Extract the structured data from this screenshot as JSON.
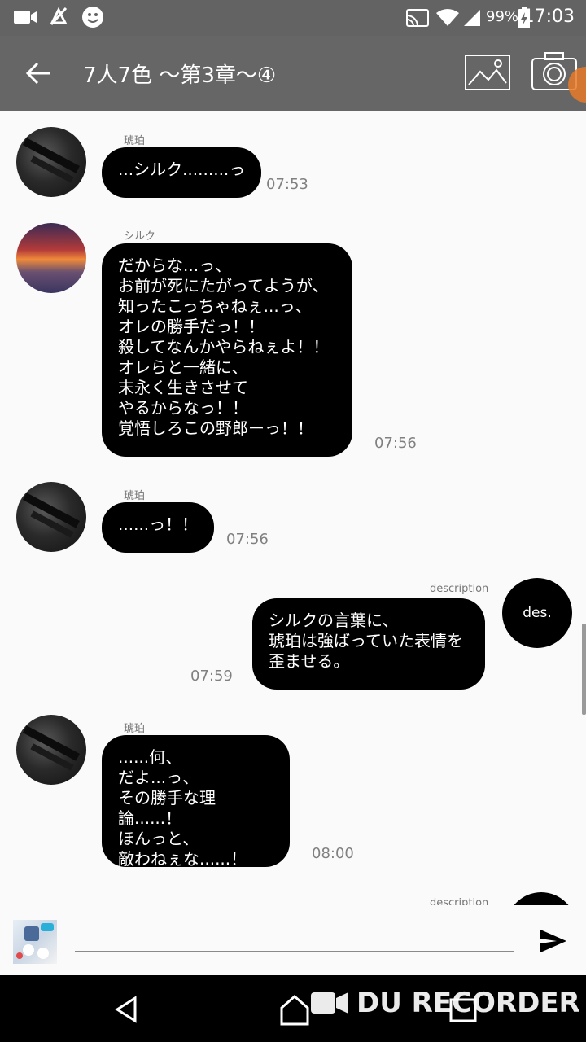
{
  "status_bar": {
    "time": "17:03",
    "battery": "99%",
    "icons": [
      "video-recording-icon",
      "mute-icon",
      "smiley-icon",
      "cast-icon",
      "wifi-icon",
      "signal-icon",
      "battery-charging-icon"
    ]
  },
  "app_bar": {
    "title": "7人7色 〜第3章〜④",
    "icons": [
      "back-arrow-icon",
      "image-icon",
      "camera-icon"
    ]
  },
  "messages": [
    {
      "sender": "琥珀",
      "avatar": "gun",
      "side": "left",
      "text": "...シルク.........っ",
      "time": "07:53"
    },
    {
      "sender": "シルク",
      "avatar": "sunset",
      "side": "left",
      "text": "だからな...っ、\nお前が死にたがってようが、\n知ったこっちゃねぇ...っ、\nオレの勝手だっ！！\n殺してなんかやらねぇよ！！\nオレらと一緒に、\n末永く生きさせて\nやるからなっ！！\n覚悟しろこの野郎ーっ！！",
      "time": "07:56"
    },
    {
      "sender": "琥珀",
      "avatar": "gun",
      "side": "left",
      "text": "......っ！！",
      "time": "07:56"
    },
    {
      "sender": "description",
      "avatar": "desc",
      "avatar_text": "des.",
      "side": "right",
      "text": "シルクの言葉に、\n琥珀は強ばっていた表情を\n歪ませる。",
      "time": "07:59"
    },
    {
      "sender": "琥珀",
      "avatar": "gun",
      "side": "left",
      "text": "......何、\nだよ...っ、\nその勝手な理論......！\nほんっと、\n敵わねぇな......！",
      "time": "08:00"
    },
    {
      "sender": "description",
      "avatar": "desc",
      "side": "right",
      "text": "",
      "time": ""
    }
  ],
  "input": {
    "placeholder": "",
    "value": ""
  },
  "nav_bar": {
    "icons": [
      "back-icon",
      "home-icon",
      "recents-icon"
    ]
  },
  "watermark": {
    "text": "DU RECORDER"
  },
  "colors": {
    "app_bar": "#666666",
    "status_bar": "#636363",
    "bubble": "#000000",
    "background": "#fafafa",
    "accent_dot": "#e87a2a"
  }
}
